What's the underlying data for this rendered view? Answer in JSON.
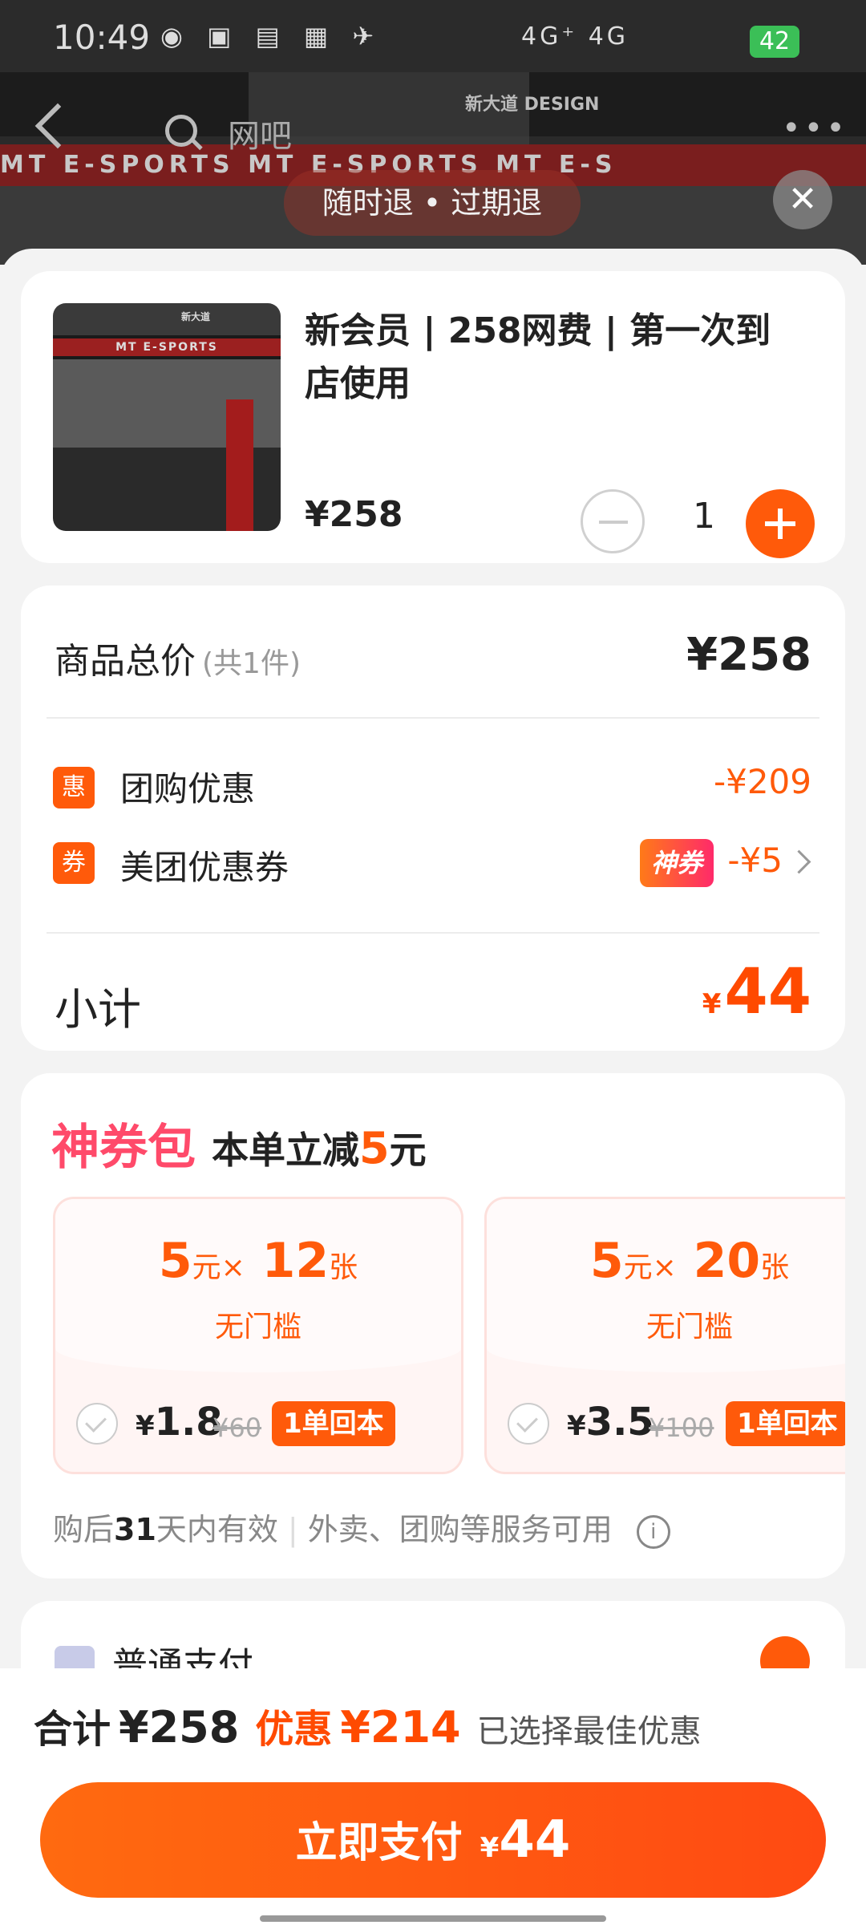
{
  "status_bar": {
    "time": "10:49",
    "network": "4G⁺ 4G",
    "battery": "42"
  },
  "hero": {
    "stripe_text": "MT E-SPORTS          MT E-SPORTS          MT E-S"
  },
  "nav": {
    "search_text": "网吧"
  },
  "refund_tag": "随时退 • 过期退",
  "product": {
    "title": "新会员 | 258网费 | 第一次到店使用",
    "price": "¥258",
    "quantity": "1",
    "thumb_stripe": "MT E-SPORTS"
  },
  "summary": {
    "total_label": "商品总价",
    "total_count": "(共1件)",
    "total_value": "¥258",
    "discounts": [
      {
        "icon": "惠",
        "label": "团购优惠",
        "value": "-¥209"
      },
      {
        "icon": "券",
        "label": "美团优惠券",
        "badge": "神券",
        "value": "-¥5"
      }
    ],
    "subtotal_label": "小计",
    "subtotal_currency": "¥",
    "subtotal_value": "44"
  },
  "coupon_pack": {
    "title": "神券包",
    "subtitle_pre": "本单立减",
    "subtitle_amount": "5",
    "subtitle_unit": "元",
    "coupons": [
      {
        "amount": "5",
        "unit": "元",
        "times": "×",
        "count": "12",
        "count_unit": "张",
        "condition": "无门槛",
        "price": "1.8",
        "currency": "¥",
        "original": "¥60",
        "badge": "1单回本"
      },
      {
        "amount": "5",
        "unit": "元",
        "times": "×",
        "count": "20",
        "count_unit": "张",
        "condition": "无门槛",
        "price": "3.5",
        "currency": "¥",
        "original": "¥100",
        "badge": "1单回本"
      }
    ],
    "footer_pre": "购后",
    "footer_days": "31",
    "footer_post": "天内有效",
    "footer_services": "外卖、团购等服务可用"
  },
  "payment": {
    "method_label": "普通支付"
  },
  "bottom": {
    "sum_label": "合计",
    "sum_value": "¥258",
    "discount_label": "优惠",
    "discount_value": "¥214",
    "best_note": "已选择最佳优惠",
    "pay_label": "立即支付",
    "pay_currency": "¥",
    "pay_value": "44"
  },
  "colors": {
    "accent": "#ff5a0a",
    "price_red": "#ff4a00",
    "pack_pink": "#ff4a6a",
    "battery_green": "#3bbf57"
  }
}
